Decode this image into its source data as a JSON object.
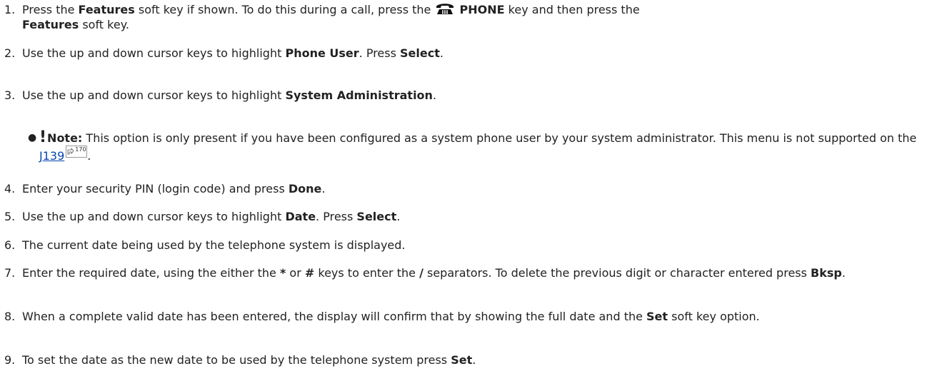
{
  "steps": [
    {
      "num": "1.",
      "parts": [
        {
          "t": "Press the "
        },
        {
          "t": "Features",
          "b": true
        },
        {
          "t": " soft key if shown. To do this during a call, press the "
        },
        {
          "icon": "phone-icon"
        },
        {
          "t": " "
        },
        {
          "t": "PHONE",
          "b": true
        },
        {
          "t": " key and then press the "
        },
        {
          "t": "Features",
          "b": true
        },
        {
          "t": " soft key."
        }
      ]
    },
    {
      "num": "2.",
      "parts": [
        {
          "t": "Use the up and down cursor keys to highlight "
        },
        {
          "t": "Phone User",
          "b": true
        },
        {
          "t": ". Press "
        },
        {
          "t": "Select",
          "b": true
        },
        {
          "t": "."
        }
      ]
    },
    {
      "num": "3.",
      "parts": [
        {
          "t": "Use the up and down cursor keys to highlight "
        },
        {
          "t": "System Administration",
          "b": true
        },
        {
          "t": "."
        }
      ]
    },
    {
      "note": true,
      "parts": [
        {
          "t": "!",
          "bang": true
        },
        {
          "t": "Note:",
          "b": true
        },
        {
          "t": " This option is only present if you have been configured as a system phone user by your system administrator. This menu is not supported on the "
        },
        {
          "t": "J139",
          "link": true
        },
        {
          "ref": "170"
        },
        {
          "t": "."
        }
      ]
    },
    {
      "num": "4.",
      "parts": [
        {
          "t": "Enter your security PIN (login code) and press "
        },
        {
          "t": "Done",
          "b": true
        },
        {
          "t": "."
        }
      ]
    },
    {
      "num": "5.",
      "parts": [
        {
          "t": "Use the up and down cursor keys to highlight "
        },
        {
          "t": "Date",
          "b": true
        },
        {
          "t": ". Press "
        },
        {
          "t": "Select",
          "b": true
        },
        {
          "t": "."
        }
      ]
    },
    {
      "num": "6.",
      "parts": [
        {
          "t": "The current date being used by the telephone system is displayed."
        }
      ]
    },
    {
      "num": "7.",
      "parts": [
        {
          "t": "Enter the required date, using the either the "
        },
        {
          "t": "*",
          "b": true
        },
        {
          "t": " or "
        },
        {
          "t": "#",
          "b": true
        },
        {
          "t": " keys to enter the "
        },
        {
          "t": "/",
          "b": true
        },
        {
          "t": " separators. To delete the previous digit or character entered press "
        },
        {
          "t": "Bksp",
          "b": true
        },
        {
          "t": "."
        }
      ]
    },
    {
      "num": "8.",
      "parts": [
        {
          "t": "When a complete valid date has been entered, the display will confirm that by showing the full date and the "
        },
        {
          "t": "Set",
          "b": true
        },
        {
          "t": " soft key option."
        }
      ]
    },
    {
      "num": "9.",
      "parts": [
        {
          "t": "To set the date as the new date to be used by the telephone system press "
        },
        {
          "t": "Set",
          "b": true
        },
        {
          "t": "."
        }
      ]
    }
  ]
}
